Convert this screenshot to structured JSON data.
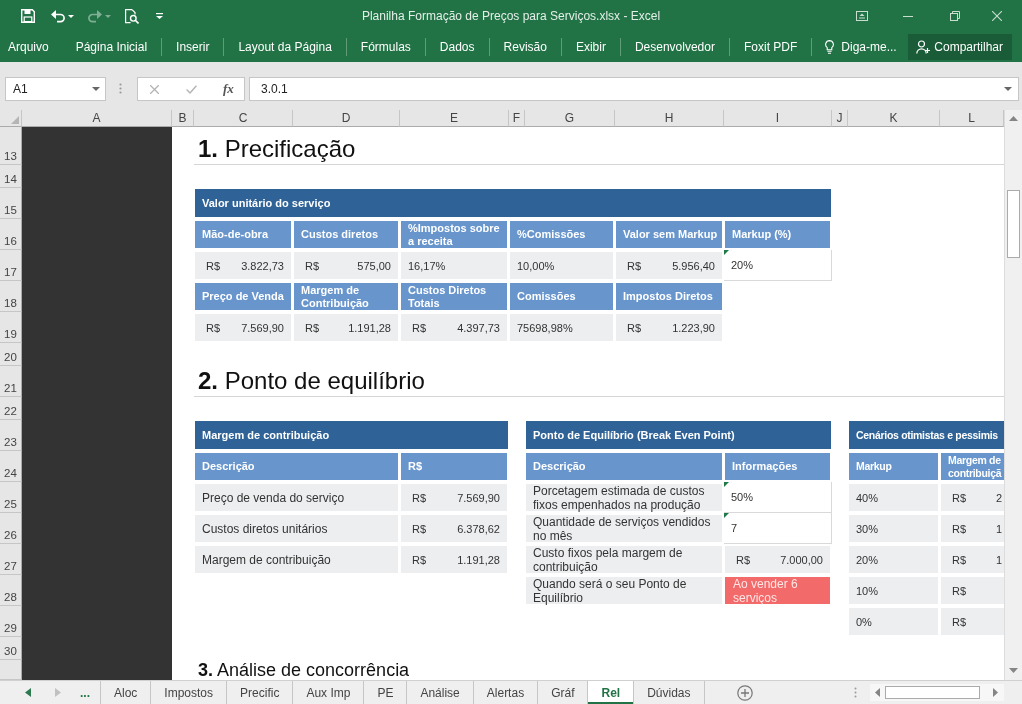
{
  "window": {
    "title": "Planilha Formação de Preços para Serviços.xlsx - Excel"
  },
  "quick_access": {
    "redo_disabled": true
  },
  "ribbon": {
    "tabs": [
      "Arquivo",
      "Página Inicial",
      "Inserir",
      "Layout da Página",
      "Fórmulas",
      "Dados",
      "Revisão",
      "Exibir",
      "Desenvolvedor",
      "Foxit PDF"
    ],
    "tell_me": "Diga-me...",
    "share": "Compartilhar"
  },
  "formula_bar": {
    "name_box": "A1",
    "edit_buttons_disabled": true,
    "function_label": "fx",
    "formula": "3.0.1"
  },
  "sheet": {
    "columns": [
      "A",
      "B",
      "C",
      "D",
      "E",
      "F",
      "G",
      "H",
      "I",
      "J",
      "K",
      "L"
    ],
    "rows": [
      "13",
      "14",
      "15",
      "16",
      "17",
      "18",
      "19",
      "20",
      "21",
      "22",
      "23",
      "24",
      "25",
      "26",
      "27",
      "28",
      "29",
      "30"
    ],
    "pricing": {
      "heading": "**1.** Precificação",
      "title": "Valor unitário do serviço",
      "rows": [
        [
          {
            "kind": "header",
            "text": "Mão-de-obra"
          },
          {
            "kind": "header",
            "text": "Custos diretos"
          },
          {
            "kind": "header",
            "text": "%Impostos sobre a receita"
          },
          {
            "kind": "header",
            "text": "%Comissões"
          },
          {
            "kind": "header",
            "text": "Valor sem Markup"
          },
          {
            "kind": "header",
            "text": "Markup (%)"
          }
        ],
        [
          {
            "kind": "currency",
            "symbol": "R$",
            "amount": "3.822,73"
          },
          {
            "kind": "currency",
            "symbol": "R$",
            "amount": "575,00"
          },
          {
            "kind": "plain",
            "text": "16,17%"
          },
          {
            "kind": "plain",
            "text": "10,00%"
          },
          {
            "kind": "currency",
            "symbol": "R$",
            "amount": "5.956,40"
          },
          {
            "kind": "input",
            "text": "20%"
          }
        ],
        [
          {
            "kind": "header",
            "text": "Preço de Venda"
          },
          {
            "kind": "header",
            "text": "Margem de Contribuição"
          },
          {
            "kind": "header",
            "text": "Custos Diretos Totais"
          },
          {
            "kind": "header",
            "text": "Comissões"
          },
          {
            "kind": "header",
            "text": "Impostos Diretos"
          }
        ],
        [
          {
            "kind": "currency",
            "symbol": "R$",
            "amount": "7.569,90"
          },
          {
            "kind": "currency",
            "symbol": "R$",
            "amount": "1.191,28"
          },
          {
            "kind": "currency",
            "symbol": "R$",
            "amount": "4.397,73"
          },
          {
            "kind": "plain",
            "text": "75698,98%"
          },
          {
            "kind": "currency",
            "symbol": "R$",
            "amount": "1.223,90"
          }
        ]
      ]
    },
    "break_even": {
      "heading": "**2.** Ponto de equilíbrio",
      "tables": [
        {
          "title": "Margem de contribuição",
          "rows": [
            [
              {
                "kind": "header",
                "text": "Descrição"
              },
              {
                "kind": "header",
                "text": "R$"
              }
            ],
            [
              {
                "kind": "label",
                "text": "Preço de venda do serviço"
              },
              {
                "kind": "currency",
                "symbol": "R$",
                "amount": "7.569,90"
              }
            ],
            [
              {
                "kind": "label",
                "text": "Custos diretos unitários"
              },
              {
                "kind": "currency",
                "symbol": "R$",
                "amount": "6.378,62"
              }
            ],
            [
              {
                "kind": "label",
                "text": "Margem de contribuição"
              },
              {
                "kind": "currency",
                "symbol": "R$",
                "amount": "1.191,28"
              }
            ]
          ]
        },
        {
          "title": "Ponto de Equilíbrio (Break Even Point)",
          "rows": [
            [
              {
                "kind": "header",
                "text": "Descrição"
              },
              {
                "kind": "header",
                "text": "Informações"
              }
            ],
            [
              {
                "kind": "label",
                "text": "Porcetagem estimada de custos fixos empenhados na produção"
              },
              {
                "kind": "input",
                "text": "50%"
              }
            ],
            [
              {
                "kind": "label",
                "text": "Quantidade de serviços vendidos no mês"
              },
              {
                "kind": "input",
                "text": "7"
              }
            ],
            [
              {
                "kind": "label",
                "text": "Custo fixos pela margem de contribuição"
              },
              {
                "kind": "currency",
                "symbol": "R$",
                "amount": "7.000,00"
              }
            ],
            [
              {
                "kind": "label",
                "text": "Quando será o seu Ponto de Equilíbrio"
              },
              {
                "kind": "alert",
                "text": "Ao vender 6 serviços"
              }
            ]
          ]
        },
        {
          "title": "Cenários otimistas e pessimis",
          "rows": [
            [
              {
                "kind": "header",
                "text": "Markup"
              },
              {
                "kind": "header",
                "text": "Margem de contribuiçã"
              }
            ],
            [
              {
                "kind": "plain",
                "text": "40%"
              },
              {
                "kind": "currency",
                "symbol": "R$",
                "amount": "2"
              }
            ],
            [
              {
                "kind": "plain",
                "text": "30%"
              },
              {
                "kind": "currency",
                "symbol": "R$",
                "amount": "1"
              }
            ],
            [
              {
                "kind": "plain",
                "text": "20%"
              },
              {
                "kind": "currency",
                "symbol": "R$",
                "amount": "1"
              }
            ],
            [
              {
                "kind": "plain",
                "text": "10%"
              },
              {
                "kind": "currency",
                "symbol": "R$"
              }
            ],
            [
              {
                "kind": "plain",
                "text": "0%"
              },
              {
                "kind": "currency",
                "symbol": "R$"
              }
            ]
          ]
        }
      ]
    },
    "section_3_heading": "**3.** Análise de concorrência"
  },
  "sheet_tabs": {
    "previous_disabled": false,
    "next_disabled": true,
    "more": "...",
    "tabs": [
      {
        "label": "Aloc",
        "selected": false
      },
      {
        "label": "Impostos",
        "selected": false
      },
      {
        "label": "Precific",
        "selected": false
      },
      {
        "label": "Aux Imp",
        "selected": false
      },
      {
        "label": "PE",
        "selected": false
      },
      {
        "label": "Análise",
        "selected": false
      },
      {
        "label": "Alertas",
        "selected": false
      },
      {
        "label": "Gráf",
        "selected": false
      },
      {
        "label": "Rel",
        "selected": true
      },
      {
        "label": "Dúvidas",
        "selected": false
      }
    ]
  }
}
